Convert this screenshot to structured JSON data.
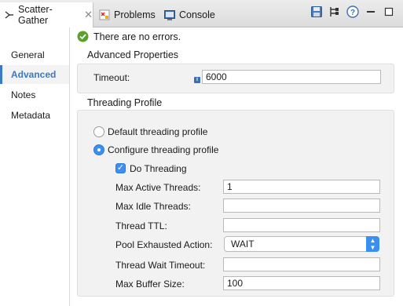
{
  "tabs": [
    {
      "label": "Scatter-Gather",
      "icon": "scatter-gather-icon",
      "active": true
    },
    {
      "label": "Problems",
      "icon": "problems-icon",
      "active": false
    },
    {
      "label": "Console",
      "icon": "console-icon",
      "active": false
    }
  ],
  "toolbar": {
    "icons": [
      "save-icon",
      "flow-icon",
      "help-icon",
      "minimize-icon",
      "maximize-icon"
    ]
  },
  "nav": {
    "items": [
      {
        "label": "General"
      },
      {
        "label": "Advanced"
      },
      {
        "label": "Notes"
      },
      {
        "label": "Metadata"
      }
    ],
    "active": "Advanced"
  },
  "status": {
    "text": "There are no errors.",
    "color": "#5aa02c"
  },
  "advanced": {
    "title": "Advanced Properties",
    "timeout_label": "Timeout:",
    "timeout_value": "6000"
  },
  "threading": {
    "title": "Threading Profile",
    "default_option": "Default threading profile",
    "configure_option": "Configure threading profile",
    "selected": "configure",
    "do_threading_label": "Do Threading",
    "do_threading_checked": true,
    "fields": {
      "max_active_label": "Max Active Threads:",
      "max_active_value": "1",
      "max_idle_label": "Max Idle Threads:",
      "max_idle_value": "",
      "ttl_label": "Thread TTL:",
      "ttl_value": "",
      "pool_exhausted_label": "Pool Exhausted Action:",
      "pool_exhausted_value": "WAIT",
      "wait_timeout_label": "Thread Wait Timeout:",
      "wait_timeout_value": "",
      "max_buffer_label": "Max Buffer Size:",
      "max_buffer_value": "100"
    }
  },
  "colors": {
    "accent": "#3b8ff0",
    "nav_active": "#3a78c8"
  }
}
